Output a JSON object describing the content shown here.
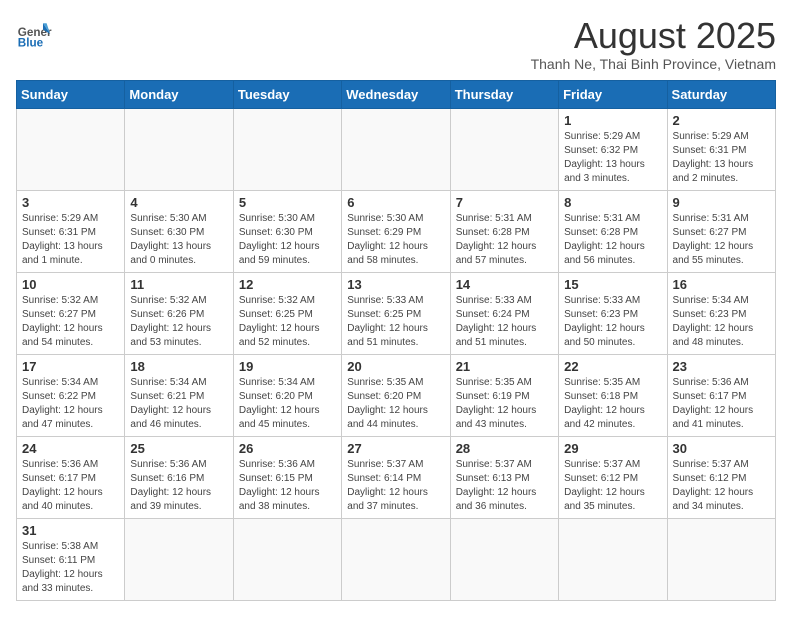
{
  "header": {
    "logo_general": "General",
    "logo_blue": "Blue",
    "month_year": "August 2025",
    "location": "Thanh Ne, Thai Binh Province, Vietnam"
  },
  "days_of_week": [
    "Sunday",
    "Monday",
    "Tuesday",
    "Wednesday",
    "Thursday",
    "Friday",
    "Saturday"
  ],
  "weeks": [
    [
      {
        "day": "",
        "info": ""
      },
      {
        "day": "",
        "info": ""
      },
      {
        "day": "",
        "info": ""
      },
      {
        "day": "",
        "info": ""
      },
      {
        "day": "",
        "info": ""
      },
      {
        "day": "1",
        "info": "Sunrise: 5:29 AM\nSunset: 6:32 PM\nDaylight: 13 hours and 3 minutes."
      },
      {
        "day": "2",
        "info": "Sunrise: 5:29 AM\nSunset: 6:31 PM\nDaylight: 13 hours and 2 minutes."
      }
    ],
    [
      {
        "day": "3",
        "info": "Sunrise: 5:29 AM\nSunset: 6:31 PM\nDaylight: 13 hours and 1 minute."
      },
      {
        "day": "4",
        "info": "Sunrise: 5:30 AM\nSunset: 6:30 PM\nDaylight: 13 hours and 0 minutes."
      },
      {
        "day": "5",
        "info": "Sunrise: 5:30 AM\nSunset: 6:30 PM\nDaylight: 12 hours and 59 minutes."
      },
      {
        "day": "6",
        "info": "Sunrise: 5:30 AM\nSunset: 6:29 PM\nDaylight: 12 hours and 58 minutes."
      },
      {
        "day": "7",
        "info": "Sunrise: 5:31 AM\nSunset: 6:28 PM\nDaylight: 12 hours and 57 minutes."
      },
      {
        "day": "8",
        "info": "Sunrise: 5:31 AM\nSunset: 6:28 PM\nDaylight: 12 hours and 56 minutes."
      },
      {
        "day": "9",
        "info": "Sunrise: 5:31 AM\nSunset: 6:27 PM\nDaylight: 12 hours and 55 minutes."
      }
    ],
    [
      {
        "day": "10",
        "info": "Sunrise: 5:32 AM\nSunset: 6:27 PM\nDaylight: 12 hours and 54 minutes."
      },
      {
        "day": "11",
        "info": "Sunrise: 5:32 AM\nSunset: 6:26 PM\nDaylight: 12 hours and 53 minutes."
      },
      {
        "day": "12",
        "info": "Sunrise: 5:32 AM\nSunset: 6:25 PM\nDaylight: 12 hours and 52 minutes."
      },
      {
        "day": "13",
        "info": "Sunrise: 5:33 AM\nSunset: 6:25 PM\nDaylight: 12 hours and 51 minutes."
      },
      {
        "day": "14",
        "info": "Sunrise: 5:33 AM\nSunset: 6:24 PM\nDaylight: 12 hours and 51 minutes."
      },
      {
        "day": "15",
        "info": "Sunrise: 5:33 AM\nSunset: 6:23 PM\nDaylight: 12 hours and 50 minutes."
      },
      {
        "day": "16",
        "info": "Sunrise: 5:34 AM\nSunset: 6:23 PM\nDaylight: 12 hours and 48 minutes."
      }
    ],
    [
      {
        "day": "17",
        "info": "Sunrise: 5:34 AM\nSunset: 6:22 PM\nDaylight: 12 hours and 47 minutes."
      },
      {
        "day": "18",
        "info": "Sunrise: 5:34 AM\nSunset: 6:21 PM\nDaylight: 12 hours and 46 minutes."
      },
      {
        "day": "19",
        "info": "Sunrise: 5:34 AM\nSunset: 6:20 PM\nDaylight: 12 hours and 45 minutes."
      },
      {
        "day": "20",
        "info": "Sunrise: 5:35 AM\nSunset: 6:20 PM\nDaylight: 12 hours and 44 minutes."
      },
      {
        "day": "21",
        "info": "Sunrise: 5:35 AM\nSunset: 6:19 PM\nDaylight: 12 hours and 43 minutes."
      },
      {
        "day": "22",
        "info": "Sunrise: 5:35 AM\nSunset: 6:18 PM\nDaylight: 12 hours and 42 minutes."
      },
      {
        "day": "23",
        "info": "Sunrise: 5:36 AM\nSunset: 6:17 PM\nDaylight: 12 hours and 41 minutes."
      }
    ],
    [
      {
        "day": "24",
        "info": "Sunrise: 5:36 AM\nSunset: 6:17 PM\nDaylight: 12 hours and 40 minutes."
      },
      {
        "day": "25",
        "info": "Sunrise: 5:36 AM\nSunset: 6:16 PM\nDaylight: 12 hours and 39 minutes."
      },
      {
        "day": "26",
        "info": "Sunrise: 5:36 AM\nSunset: 6:15 PM\nDaylight: 12 hours and 38 minutes."
      },
      {
        "day": "27",
        "info": "Sunrise: 5:37 AM\nSunset: 6:14 PM\nDaylight: 12 hours and 37 minutes."
      },
      {
        "day": "28",
        "info": "Sunrise: 5:37 AM\nSunset: 6:13 PM\nDaylight: 12 hours and 36 minutes."
      },
      {
        "day": "29",
        "info": "Sunrise: 5:37 AM\nSunset: 6:12 PM\nDaylight: 12 hours and 35 minutes."
      },
      {
        "day": "30",
        "info": "Sunrise: 5:37 AM\nSunset: 6:12 PM\nDaylight: 12 hours and 34 minutes."
      }
    ],
    [
      {
        "day": "31",
        "info": "Sunrise: 5:38 AM\nSunset: 6:11 PM\nDaylight: 12 hours and 33 minutes."
      },
      {
        "day": "",
        "info": ""
      },
      {
        "day": "",
        "info": ""
      },
      {
        "day": "",
        "info": ""
      },
      {
        "day": "",
        "info": ""
      },
      {
        "day": "",
        "info": ""
      },
      {
        "day": "",
        "info": ""
      }
    ]
  ]
}
